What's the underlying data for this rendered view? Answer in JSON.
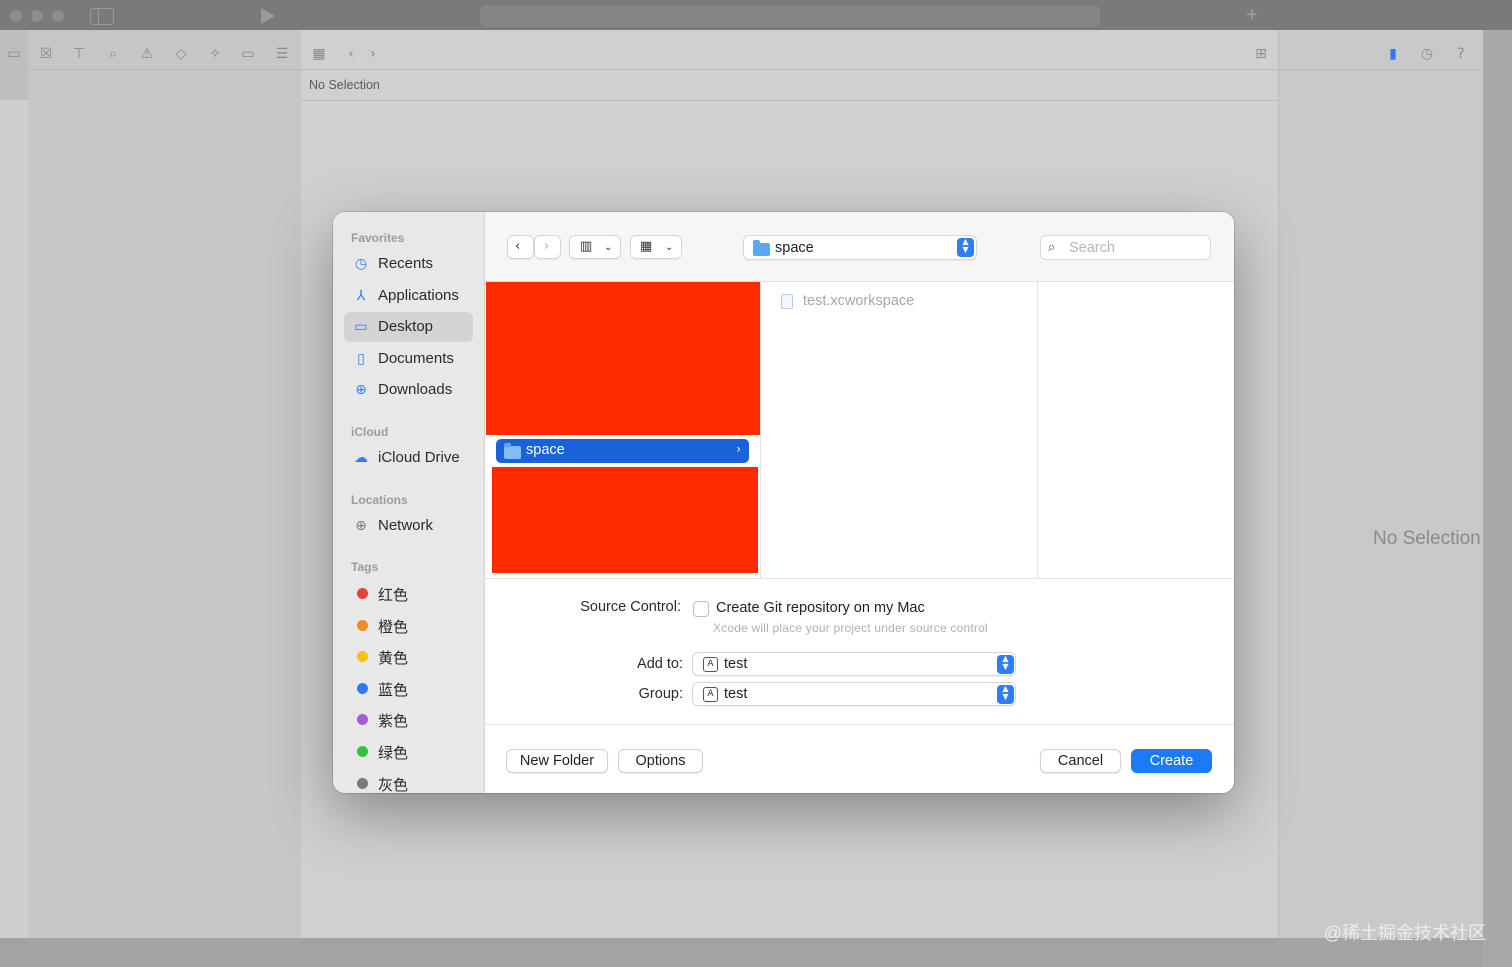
{
  "background": {
    "editor_placeholder": "No Selection",
    "inspector_placeholder": "No Selection",
    "watermark": "@稀土掘金技术社区"
  },
  "sidebar": {
    "sections": {
      "favorites": "Favorites",
      "icloud": "iCloud",
      "locations": "Locations",
      "tags": "Tags"
    },
    "favorites": [
      {
        "label": "Recents",
        "icon": "clock-icon"
      },
      {
        "label": "Applications",
        "icon": "applications-icon"
      },
      {
        "label": "Desktop",
        "icon": "desktop-icon",
        "selected": true
      },
      {
        "label": "Documents",
        "icon": "document-icon"
      },
      {
        "label": "Downloads",
        "icon": "download-icon"
      }
    ],
    "icloud": [
      {
        "label": "iCloud Drive",
        "icon": "cloud-icon"
      }
    ],
    "locations": [
      {
        "label": "Network",
        "icon": "globe-icon"
      }
    ],
    "tags": [
      {
        "label": "红色",
        "color": "#e8413c"
      },
      {
        "label": "橙色",
        "color": "#f08a24"
      },
      {
        "label": "黄色",
        "color": "#f5c20d"
      },
      {
        "label": "蓝色",
        "color": "#2f7cf6"
      },
      {
        "label": "紫色",
        "color": "#a55bd1"
      },
      {
        "label": "绿色",
        "color": "#34c048"
      },
      {
        "label": "灰色",
        "color": "#7a7a7a"
      }
    ]
  },
  "toolbar": {
    "current_folder": "space",
    "search_placeholder": "Search"
  },
  "browser": {
    "selected_folder": "space",
    "files": [
      "test.xcworkspace"
    ]
  },
  "form": {
    "source_control_label": "Source Control:",
    "git_checkbox_label": "Create Git repository on my Mac",
    "git_checked": false,
    "git_help": "Xcode will place your project under source control",
    "add_to_label": "Add to:",
    "add_to_value": "test",
    "group_label": "Group:",
    "group_value": "test"
  },
  "footer": {
    "new_folder": "New Folder",
    "options": "Options",
    "cancel": "Cancel",
    "create": "Create"
  },
  "colors": {
    "accent": "#1a7cf5",
    "selection": "#1a62d9",
    "redaction": "#ff2a00"
  }
}
